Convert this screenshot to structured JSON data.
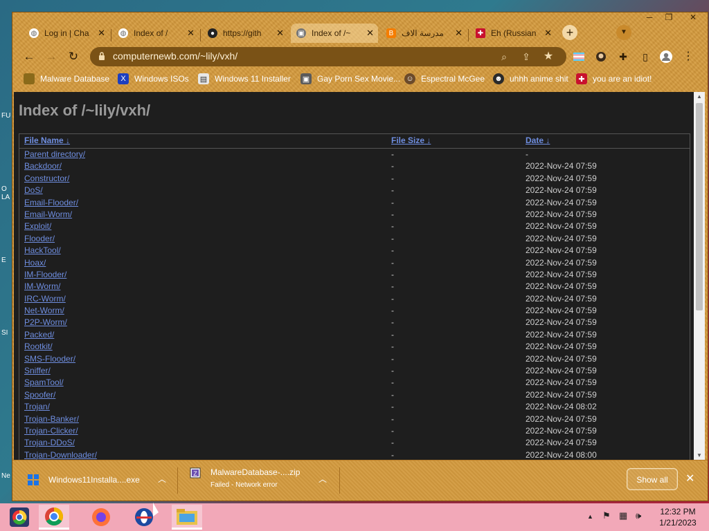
{
  "desktop": {
    "labels": [
      "FU",
      "O",
      "LA",
      "E",
      "SI",
      "Ne"
    ]
  },
  "browser": {
    "tabs": [
      {
        "title": "Log in | Cha",
        "icon": "globe-icon"
      },
      {
        "title": "Index of /",
        "icon": "globe-icon"
      },
      {
        "title": "https://gith",
        "icon": "github-icon"
      },
      {
        "title": "Index of /~",
        "icon": "site-icon"
      },
      {
        "title": "مدرسة الاف",
        "icon": "blogger-icon"
      },
      {
        "title": "Eh (Russian",
        "icon": "flag-icon"
      }
    ],
    "active_tab": 3,
    "url": "computernewb.com/~lily/vxh/",
    "bookmarks": [
      {
        "label": "Malware Database",
        "icon": "folder-icon"
      },
      {
        "label": "Windows ISOs",
        "icon": "x-icon"
      },
      {
        "label": "Windows 11 Installer",
        "icon": "image-icon"
      },
      {
        "label": "Gay Porn Sex Movie...",
        "icon": "site-icon"
      },
      {
        "label": "Espectral McGee",
        "icon": "face-icon"
      },
      {
        "label": "uhhh anime shit",
        "icon": "anime-icon"
      },
      {
        "label": "you are an idiot!",
        "icon": "flag-icon"
      }
    ]
  },
  "page": {
    "title": "Index of /~lily/vxh/",
    "columns": {
      "name": "File Name  ↓",
      "size": "File Size  ↓",
      "date": "Date  ↓"
    },
    "rows": [
      {
        "name": "Parent directory/",
        "size": "-",
        "date": "-"
      },
      {
        "name": "Backdoor/",
        "size": "-",
        "date": "2022-Nov-24 07:59"
      },
      {
        "name": "Constructor/",
        "size": "-",
        "date": "2022-Nov-24 07:59"
      },
      {
        "name": "DoS/",
        "size": "-",
        "date": "2022-Nov-24 07:59"
      },
      {
        "name": "Email-Flooder/",
        "size": "-",
        "date": "2022-Nov-24 07:59"
      },
      {
        "name": "Email-Worm/",
        "size": "-",
        "date": "2022-Nov-24 07:59"
      },
      {
        "name": "Exploit/",
        "size": "-",
        "date": "2022-Nov-24 07:59"
      },
      {
        "name": "Flooder/",
        "size": "-",
        "date": "2022-Nov-24 07:59"
      },
      {
        "name": "HackTool/",
        "size": "-",
        "date": "2022-Nov-24 07:59"
      },
      {
        "name": "Hoax/",
        "size": "-",
        "date": "2022-Nov-24 07:59"
      },
      {
        "name": "IM-Flooder/",
        "size": "-",
        "date": "2022-Nov-24 07:59"
      },
      {
        "name": "IM-Worm/",
        "size": "-",
        "date": "2022-Nov-24 07:59"
      },
      {
        "name": "IRC-Worm/",
        "size": "-",
        "date": "2022-Nov-24 07:59"
      },
      {
        "name": "Net-Worm/",
        "size": "-",
        "date": "2022-Nov-24 07:59"
      },
      {
        "name": "P2P-Worm/",
        "size": "-",
        "date": "2022-Nov-24 07:59"
      },
      {
        "name": "Packed/",
        "size": "-",
        "date": "2022-Nov-24 07:59"
      },
      {
        "name": "Rootkit/",
        "size": "-",
        "date": "2022-Nov-24 07:59"
      },
      {
        "name": "SMS-Flooder/",
        "size": "-",
        "date": "2022-Nov-24 07:59"
      },
      {
        "name": "Sniffer/",
        "size": "-",
        "date": "2022-Nov-24 07:59"
      },
      {
        "name": "SpamTool/",
        "size": "-",
        "date": "2022-Nov-24 07:59"
      },
      {
        "name": "Spoofer/",
        "size": "-",
        "date": "2022-Nov-24 07:59"
      },
      {
        "name": "Trojan/",
        "size": "-",
        "date": "2022-Nov-24 08:02"
      },
      {
        "name": "Trojan-Banker/",
        "size": "-",
        "date": "2022-Nov-24 07:59"
      },
      {
        "name": "Trojan-Clicker/",
        "size": "-",
        "date": "2022-Nov-24 07:59"
      },
      {
        "name": "Trojan-DDoS/",
        "size": "-",
        "date": "2022-Nov-24 07:59"
      },
      {
        "name": "Trojan-Downloader/",
        "size": "-",
        "date": "2022-Nov-24 08:00"
      }
    ]
  },
  "downloads": {
    "items": [
      {
        "name": "Windows11Installa....exe",
        "status": ""
      },
      {
        "name": "MalwareDatabase-....zip",
        "status": "Failed - Network error"
      }
    ],
    "show_all": "Show all"
  },
  "taskbar": {
    "apps": [
      "chrome-color-icon",
      "chrome-icon",
      "firefox-icon",
      "opera-icon",
      "file-explorer-icon"
    ],
    "active_app": 1,
    "time": "12:32 PM",
    "date": "1/21/2023"
  }
}
